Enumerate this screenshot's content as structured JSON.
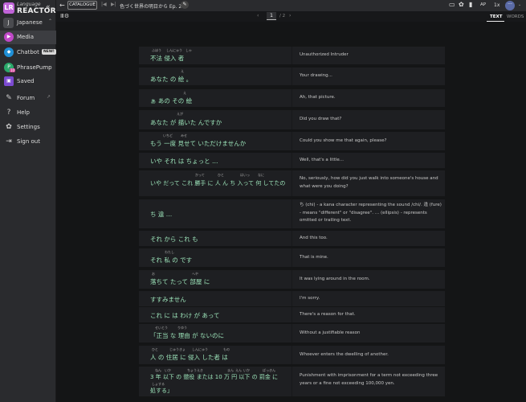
{
  "app": {
    "name_top": "Language",
    "name_bottom": "REACTOR",
    "logo_badge": "LR",
    "collapse_glyph": "«"
  },
  "language": {
    "initial": "J",
    "name": "Japanese",
    "caret": "⌃"
  },
  "sidebar": {
    "items": [
      {
        "label": "Media",
        "icon": "play-icon",
        "glyph": "▶",
        "active": true
      },
      {
        "label": "Chatbot",
        "icon": "chat-icon",
        "glyph": "◆",
        "badge": "NEW!"
      },
      {
        "label": "PhrasePump",
        "icon": "phrasepump-icon",
        "glyph": "P",
        "badge": "10"
      },
      {
        "label": "Saved",
        "icon": "saved-icon",
        "glyph": "▣"
      },
      {
        "label": "Forum",
        "icon": "forum-icon",
        "glyph": "✎",
        "ext": "↗"
      },
      {
        "label": "Help",
        "icon": "help-icon",
        "glyph": "?"
      },
      {
        "label": "Settings",
        "icon": "gear-icon",
        "glyph": "✿"
      },
      {
        "label": "Sign out",
        "icon": "signout-icon",
        "glyph": "⇥"
      }
    ]
  },
  "topbar": {
    "back_glyph": "←",
    "catalogue": "CATALOGUE",
    "prev_glyph": "|◀",
    "next_glyph": "▶|",
    "title": "色づく世界の明日から Ep. 2",
    "pencil_glyph": "✎",
    "right": {
      "icons": [
        {
          "name": "cc-icon",
          "glyph": "▭"
        },
        {
          "name": "gear-icon",
          "glyph": "✿"
        },
        {
          "name": "book-icon",
          "glyph": "▮"
        }
      ],
      "ap": "AP",
      "speed": "1x",
      "more": "···",
      "caret": "⌄"
    }
  },
  "subbar": {
    "grid_glyph": "Ⅲ⚙",
    "page_prev": "‹",
    "page_current": "1",
    "page_total": "/ 2",
    "page_next": "›",
    "tab_text": "TEXT",
    "tab_words": "WORDS"
  },
  "rows": [
    {
      "jp": "不法 侵入 者",
      "en": "Unauthorized Intruder"
    },
    {
      "jp": "あなた の 絵 。",
      "en": "Your drawing..."
    },
    {
      "jp": "ぁ あの その 絵",
      "en": "Ah, that picture."
    },
    {
      "jp": "あなた が 描いた んですか",
      "en": "Did you draw that?"
    },
    {
      "jp": "もう 一度 見せて いただけませんか",
      "en": "Could you show me that again, please?"
    },
    {
      "jp": "いや それ は ちょっと …",
      "en": "Well, that's a little..."
    },
    {
      "jp": "いや だって これ 勝手 に 人 ん ち 入って 何 してたの",
      "en": "No, seriously, how did you just walk into someone's house and what were you doing?"
    },
    {
      "jp": "ち 違 …",
      "en": "ち (chi) - a kana character representing the sound /chi/. 違 (fure) - means \"different\" or \"disagree\". … (ellipsis) - represents omitted or trailing text."
    },
    {
      "jp": "それ から これ も",
      "en": "And this too."
    },
    {
      "jp": "それ 私 の です",
      "en": "That is mine."
    },
    {
      "jp": "落ちて たって 部屋 に",
      "en": "It was lying around in the room."
    },
    {
      "jp": "すすみません",
      "en": "I'm sorry."
    },
    {
      "jp": "これ に は わけ が あって",
      "en": "There's a reason for that."
    },
    {
      "jp": "「正当 な 理由 が ないのに",
      "en": "Without a justifiable reason"
    },
    {
      "jp": "人 の 住居 に 侵入 した者 は",
      "en": "Whoever enters the dwelling of another."
    },
    {
      "jp": "3 年 以下 の 懲役 または 10 万 円 以下 の 罰金 に",
      "jp2": "処する」",
      "en": "Punishment with imprisonment for a term not exceeding three years or a fine not exceeding 100,000 yen."
    }
  ],
  "furigana": {
    "r0a": "ふほう",
    "r0b": "しんにゅう",
    "r0c": "しゃ",
    "r1": "え",
    "r2": "え",
    "r3": "えが",
    "r4a": "いちど",
    "r4b": "みせ",
    "r6a": "かって",
    "r6b": "ひと",
    "r6c": "はいっ",
    "r6d": "なに",
    "r9": "わたし",
    "r10a": "お",
    "r10b": "へや",
    "r13a": "せいとう",
    "r13b": "りゆう",
    "r14a": "ひと",
    "r14b": "じゅうきょ",
    "r14c": "しんにゅう",
    "r14d": "もの",
    "r15a": "ねん",
    "r15b": "いか",
    "r15c": "ちょうえき",
    "r15d": "まん",
    "r15e": "えん",
    "r15f": "いか",
    "r15g": "ばっきん",
    "r15h": "しょする"
  }
}
